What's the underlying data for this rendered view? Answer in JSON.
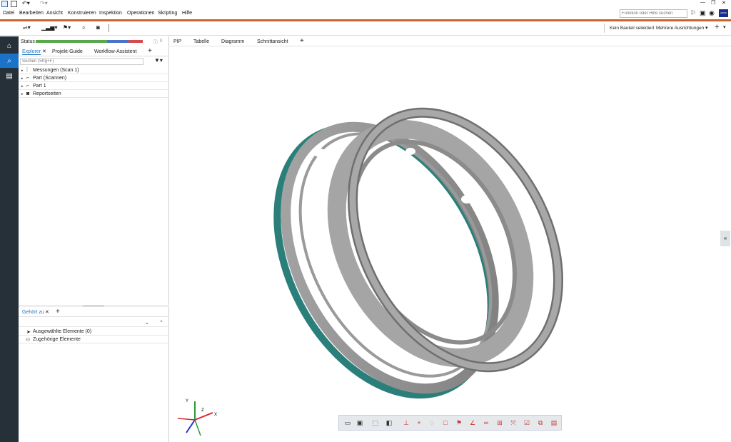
{
  "titlebar": {
    "min_glyph": "—",
    "restore_glyph": "❐",
    "close_glyph": "✕"
  },
  "menu": [
    "Datei",
    "Bearbeiten",
    "Ansicht",
    "Konstruieren",
    "Inspektion",
    "Operationen",
    "Skripting",
    "Hilfe"
  ],
  "search": {
    "placeholder": "Funktion oder Hilfe suchen"
  },
  "brand_text": "ZEISS",
  "toolbar_right": {
    "selection": "Kein Bauteil selektiert",
    "alignments": "Mehrere Ausrichtungen"
  },
  "status": {
    "label": "Status",
    "count": "0"
  },
  "left_tabs": [
    "Explorer",
    "Projekt-Guide",
    "Workflow-Assistent"
  ],
  "left_search_placeholder": "Suchen (Strg+F)",
  "tree": [
    "Messungen (Scan 1)",
    "Part (Scannen)",
    "Part 1",
    "Reportseiten"
  ],
  "belongs_tab": "Gehört zu",
  "belongs_items": [
    "Ausgewählte Elemente (0)",
    "Zugehörige Elemente"
  ],
  "view_tabs": [
    "PIP",
    "Tabelle",
    "Diagramm",
    "Schnittansicht"
  ],
  "plus": "+",
  "axes": {
    "x": "X",
    "y": "Y",
    "z": "Z"
  },
  "collapse_glyph": "«",
  "colors": {
    "accent": "#c8642a",
    "rail": "#263038",
    "explorer_tab": "#1a73c8",
    "mesh": "#8f8f8f",
    "mesh_dark": "#666",
    "mesh_deviation": "#2b7f7a"
  }
}
